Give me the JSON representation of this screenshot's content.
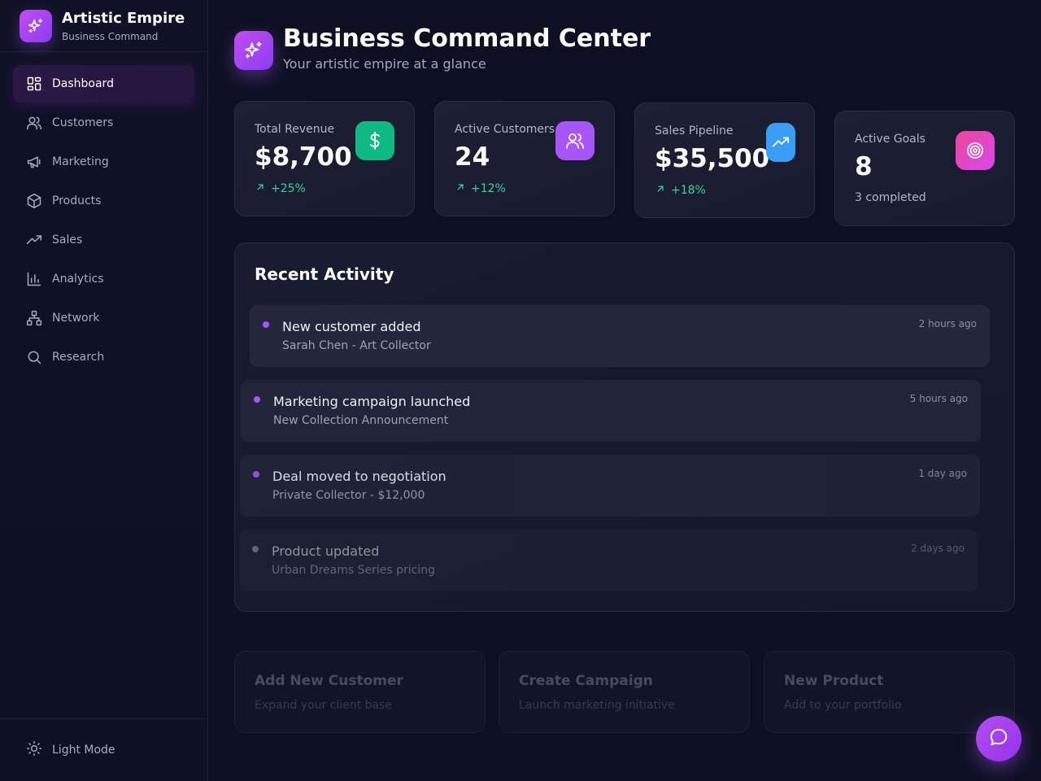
{
  "brand": {
    "title": "Artistic Empire",
    "subtitle": "Business Command",
    "logo_icon": "sparkles-icon"
  },
  "sidebar": {
    "items": [
      {
        "label": "Dashboard",
        "icon": "dashboard-grid-icon",
        "active": true
      },
      {
        "label": "Customers",
        "icon": "users-icon",
        "active": false
      },
      {
        "label": "Marketing",
        "icon": "megaphone-icon",
        "active": false
      },
      {
        "label": "Products",
        "icon": "box-icon",
        "active": false
      },
      {
        "label": "Sales",
        "icon": "trending-up-icon",
        "active": false
      },
      {
        "label": "Analytics",
        "icon": "bar-chart-icon",
        "active": false
      },
      {
        "label": "Network",
        "icon": "network-icon",
        "active": false
      },
      {
        "label": "Research",
        "icon": "search-icon",
        "active": false
      }
    ],
    "theme_toggle": {
      "label": "Light Mode",
      "icon": "sun-icon"
    }
  },
  "header": {
    "title": "Business Command Center",
    "subtitle": "Your artistic empire at a glance",
    "icon": "sparkles-icon"
  },
  "stats": [
    {
      "label": "Total Revenue",
      "value": "$8,700",
      "trend": "+25%",
      "icon": "dollar-icon",
      "color": "#10b981"
    },
    {
      "label": "Active Customers",
      "value": "24",
      "trend": "+12%",
      "icon": "users-icon",
      "color": "#a855f7"
    },
    {
      "label": "Sales Pipeline",
      "value": "$35,500",
      "trend": "+18%",
      "icon": "trending-up-icon",
      "color": "#3b9ef5"
    },
    {
      "label": "Active Goals",
      "value": "8",
      "note": "3 completed",
      "icon": "target-icon",
      "color": "#ec4899"
    }
  ],
  "activity": {
    "title": "Recent Activity",
    "items": [
      {
        "title": "New customer added",
        "description": "Sarah Chen - Art Collector",
        "time": "2 hours ago"
      },
      {
        "title": "Marketing campaign launched",
        "description": "New Collection Announcement",
        "time": "5 hours ago"
      },
      {
        "title": "Deal moved to negotiation",
        "description": "Private Collector - $12,000",
        "time": "1 day ago"
      },
      {
        "title": "Product updated",
        "description": "Urban Dreams Series pricing",
        "time": "2 days ago"
      }
    ]
  },
  "quick_actions": [
    {
      "title": "Add New Customer",
      "description": "Expand your client base"
    },
    {
      "title": "Create Campaign",
      "description": "Launch marketing initiative"
    },
    {
      "title": "New Product",
      "description": "Add to your portfolio"
    }
  ],
  "chat_button": {
    "icon": "chat-bubble-icon"
  },
  "colors": {
    "accent": "#a855f7",
    "positive": "#34d399",
    "background": "#0d1022"
  }
}
